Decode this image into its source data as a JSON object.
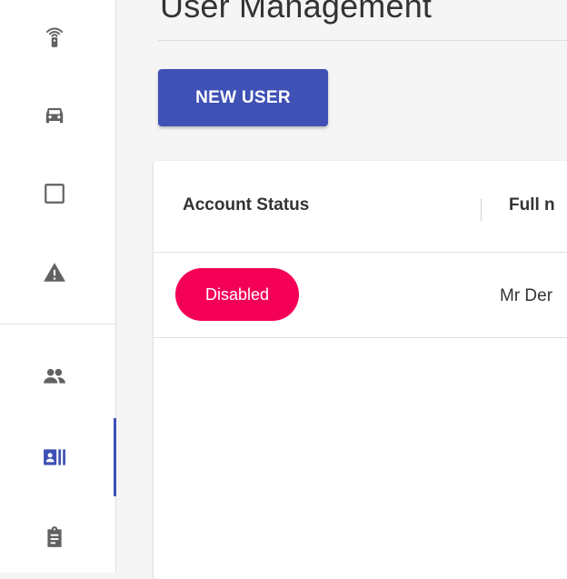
{
  "page": {
    "title": "User Management",
    "new_user_label": "NEW USER"
  },
  "sidebar": {
    "items": [
      {
        "icon": "wifi-tower-icon",
        "active": false
      },
      {
        "icon": "car-icon",
        "active": false
      },
      {
        "icon": "square-icon",
        "active": false
      },
      {
        "icon": "warning-icon",
        "active": false
      },
      {
        "icon": "people-icon",
        "active": false
      },
      {
        "icon": "id-card-icon",
        "active": true
      },
      {
        "icon": "clipboard-icon",
        "active": false
      }
    ],
    "icon_color": "#616161",
    "active_color": "#3f51b5"
  },
  "table": {
    "columns": [
      "Account Status",
      "Full n"
    ],
    "rows": [
      {
        "status": "Disabled",
        "full_name": "Mr Der"
      }
    ]
  },
  "colors": {
    "primary": "#3f51b5",
    "badge_disabled": "#f50057",
    "background": "#f5f5f5"
  }
}
